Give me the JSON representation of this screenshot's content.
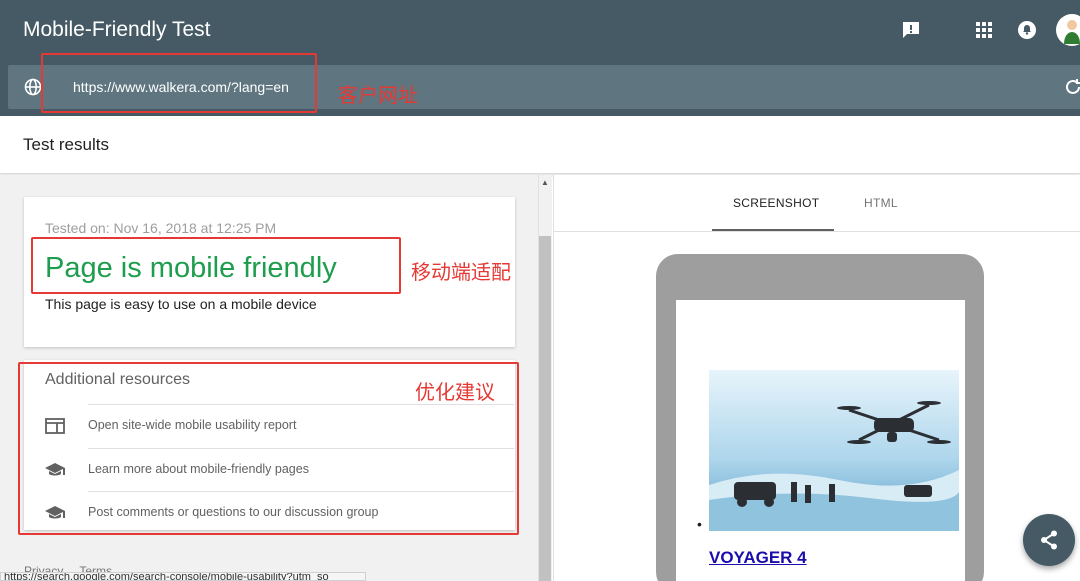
{
  "header": {
    "title": "Mobile-Friendly Test"
  },
  "urlbar": {
    "url": "https://www.walkera.com/?lang=en"
  },
  "annotations": {
    "url_label": "客户网址",
    "verdict_label": "移动端适配",
    "resources_label": "优化建议"
  },
  "results": {
    "title": "Test results",
    "tested_on": "Tested on: Nov 16, 2018 at 12:25 PM",
    "verdict": "Page is mobile friendly",
    "verdict_sub": "This page is easy to use on a mobile device"
  },
  "additional": {
    "title": "Additional resources",
    "items": [
      {
        "label": "Open site-wide mobile usability report",
        "icon": "dashboard-icon"
      },
      {
        "label": "Learn more about mobile-friendly pages",
        "icon": "school-icon"
      },
      {
        "label": "Post comments or questions to our discussion group",
        "icon": "school-icon"
      }
    ]
  },
  "footer": {
    "privacy": "Privacy",
    "terms": "Terms",
    "status_url": "https://search.google.com/search-console/mobile-usability?utm_so"
  },
  "preview": {
    "tabs": [
      {
        "label": "SCREENSHOT",
        "active": true
      },
      {
        "label": "HTML",
        "active": false
      }
    ],
    "bullet": "•",
    "link_text": "VOYAGER 4"
  },
  "colors": {
    "header_bg": "#455a64",
    "success_green": "#1e9d4e",
    "annotation_red": "#e53935",
    "link_blue": "#1a0dab"
  }
}
